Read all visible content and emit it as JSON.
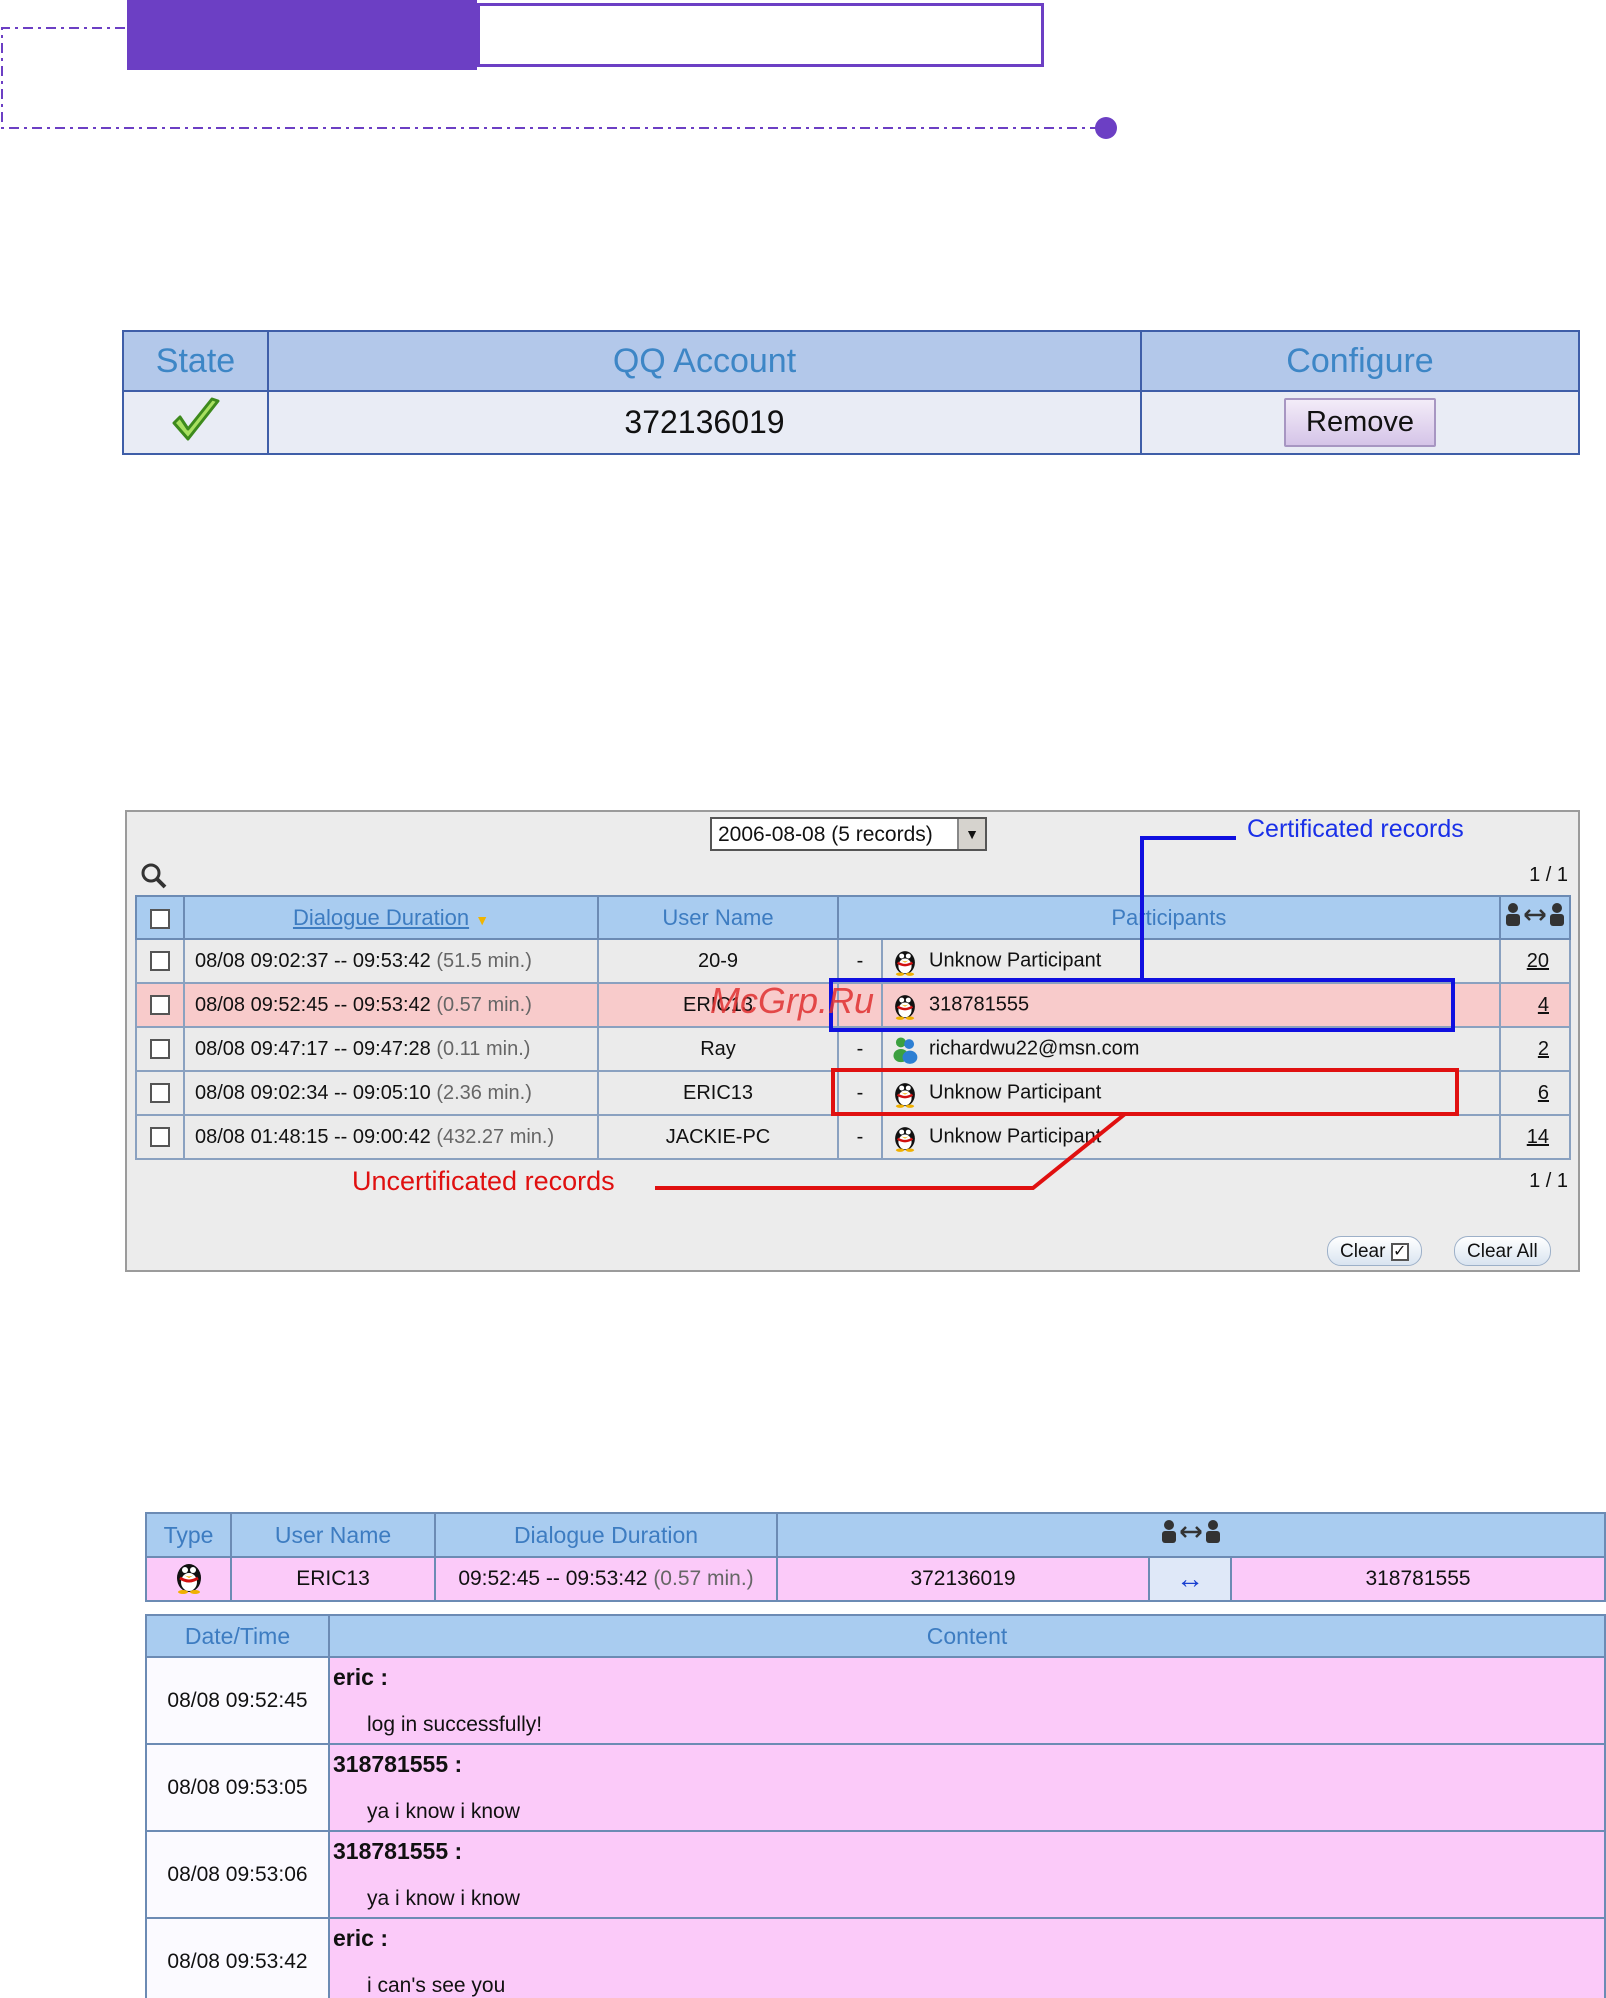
{
  "qq_table": {
    "headers": [
      "State",
      "QQ Account",
      "Configure"
    ],
    "row": {
      "state_icon": "green-check-icon",
      "account": "372136019",
      "button": "Remove"
    }
  },
  "records_panel": {
    "date_select": "2006-08-08 (5 records)",
    "page_top": "1 / 1",
    "page_bottom": "1 / 1",
    "headers": {
      "duration": "Dialogue Duration",
      "user": "User Name",
      "participants": "Participants"
    },
    "rows": [
      {
        "time": "08/08 09:02:37 -- 09:53:42",
        "dur": "(51.5 min.)",
        "user": "20-9",
        "dash": "-",
        "icon": "qq-penguin-icon",
        "participant": "Unknow Participant",
        "count": "20",
        "highlight": false
      },
      {
        "time": "08/08 09:52:45 -- 09:53:42",
        "dur": "(0.57 min.)",
        "user": "ERIC13",
        "dash": "",
        "icon": "qq-penguin-icon",
        "participant": "318781555",
        "count": "4",
        "highlight": true
      },
      {
        "time": "08/08 09:47:17 -- 09:47:28",
        "dur": "(0.11 min.)",
        "user": "Ray",
        "dash": "-",
        "icon": "msn-people-icon",
        "participant": "richardwu22@msn.com",
        "count": "2",
        "highlight": false
      },
      {
        "time": "08/08 09:02:34 -- 09:05:10",
        "dur": "(2.36 min.)",
        "user": "ERIC13",
        "dash": "-",
        "icon": "qq-penguin-icon",
        "participant": "Unknow Participant",
        "count": "6",
        "highlight": false
      },
      {
        "time": "08/08 01:48:15 -- 09:00:42",
        "dur": "(432.27 min.)",
        "user": "JACKIE-PC",
        "dash": "-",
        "icon": "qq-penguin-icon",
        "participant": "Unknow Participant",
        "count": "14",
        "highlight": false
      }
    ],
    "btn_clear": "Clear",
    "btn_clear_all": "Clear All",
    "annotation_cert": "Certificated records",
    "annotation_uncert": "Uncertificated records",
    "watermark": "McGrp.Ru"
  },
  "detail": {
    "headers": [
      "Type",
      "User Name",
      "Dialogue Duration"
    ],
    "user": "ERIC13",
    "time": "09:52:45 -- 09:53:42",
    "dur": "(0.57 min.)",
    "from": "372136019",
    "to": "318781555",
    "msg_headers": [
      "Date/Time",
      "Content"
    ],
    "messages": [
      {
        "dt": "08/08 09:52:45",
        "speaker": "eric :",
        "text": "log in successfully!"
      },
      {
        "dt": "08/08 09:53:05",
        "speaker": "318781555 :",
        "text": "ya i know i know"
      },
      {
        "dt": "08/08 09:53:06",
        "speaker": "318781555 :",
        "text": "ya i know i know"
      },
      {
        "dt": "08/08 09:53:42",
        "speaker": "eric :",
        "text": "i can's see you"
      }
    ]
  },
  "colors": {
    "accent": "#6c3fc4",
    "header_blue": "#a9ccf0",
    "highlight_row": "#f8cbcb",
    "chat_pink": "#fbcaf9",
    "cert_blue": "#1010e0",
    "uncert_red": "#e01010"
  }
}
